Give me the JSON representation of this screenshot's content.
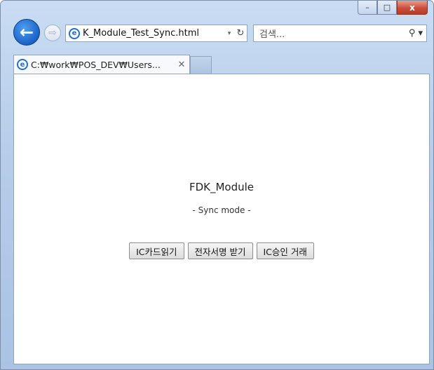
{
  "window": {
    "close_label": "x",
    "minimize_label": "–",
    "maximize_label": "□"
  },
  "nav": {
    "back_glyph": "←",
    "forward_glyph": "⇨",
    "address": "K_Module_Test_Sync.html",
    "address_dropdown": "▾",
    "refresh_glyph": "↻",
    "search_placeholder": "검색...",
    "search_glyph": "⚲ ▾"
  },
  "tabs": [
    {
      "label": "C:₩work₩POS_DEV₩Users...",
      "close": "✕"
    }
  ],
  "page": {
    "title": "FDK_Module",
    "subtitle": "- Sync mode -",
    "buttons": [
      "IC카드읽기",
      "전자서명 받기",
      "IC승인 거래"
    ]
  }
}
